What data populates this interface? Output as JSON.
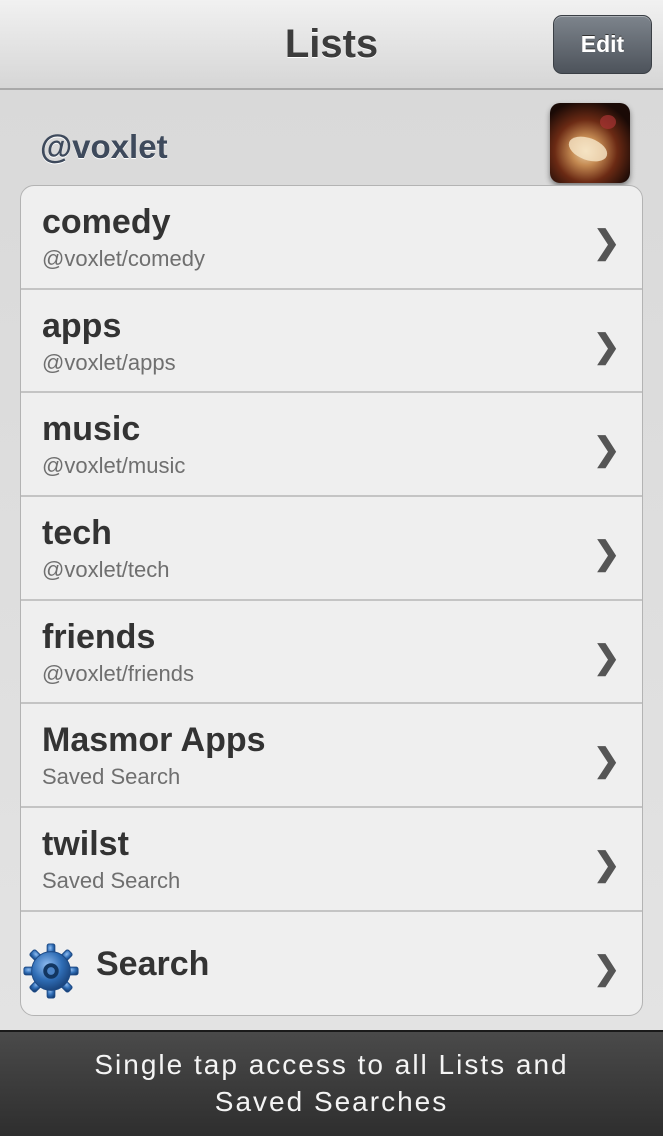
{
  "navbar": {
    "title": "Lists",
    "edit_label": "Edit"
  },
  "account": {
    "handle": "@voxlet"
  },
  "lists": [
    {
      "title": "comedy",
      "subtitle": "@voxlet/comedy"
    },
    {
      "title": "apps",
      "subtitle": "@voxlet/apps"
    },
    {
      "title": "music",
      "subtitle": "@voxlet/music"
    },
    {
      "title": "tech",
      "subtitle": "@voxlet/tech"
    },
    {
      "title": "friends",
      "subtitle": "@voxlet/friends"
    },
    {
      "title": "Masmor Apps",
      "subtitle": "Saved Search"
    },
    {
      "title": "twilst",
      "subtitle": "Saved Search"
    }
  ],
  "search_row": {
    "label": "Search",
    "icon": "gear-icon"
  },
  "chevron_glyph": "❯",
  "caption": {
    "line1": "Single tap access to all Lists and",
    "line2": "Saved Searches"
  },
  "colors": {
    "nav_title": "#3c3c3c",
    "account_handle": "#3e4a5c",
    "edit_button": "#5b6168",
    "gear_blue": "#2f6db5",
    "caption_bg": "#3a3a3a"
  }
}
